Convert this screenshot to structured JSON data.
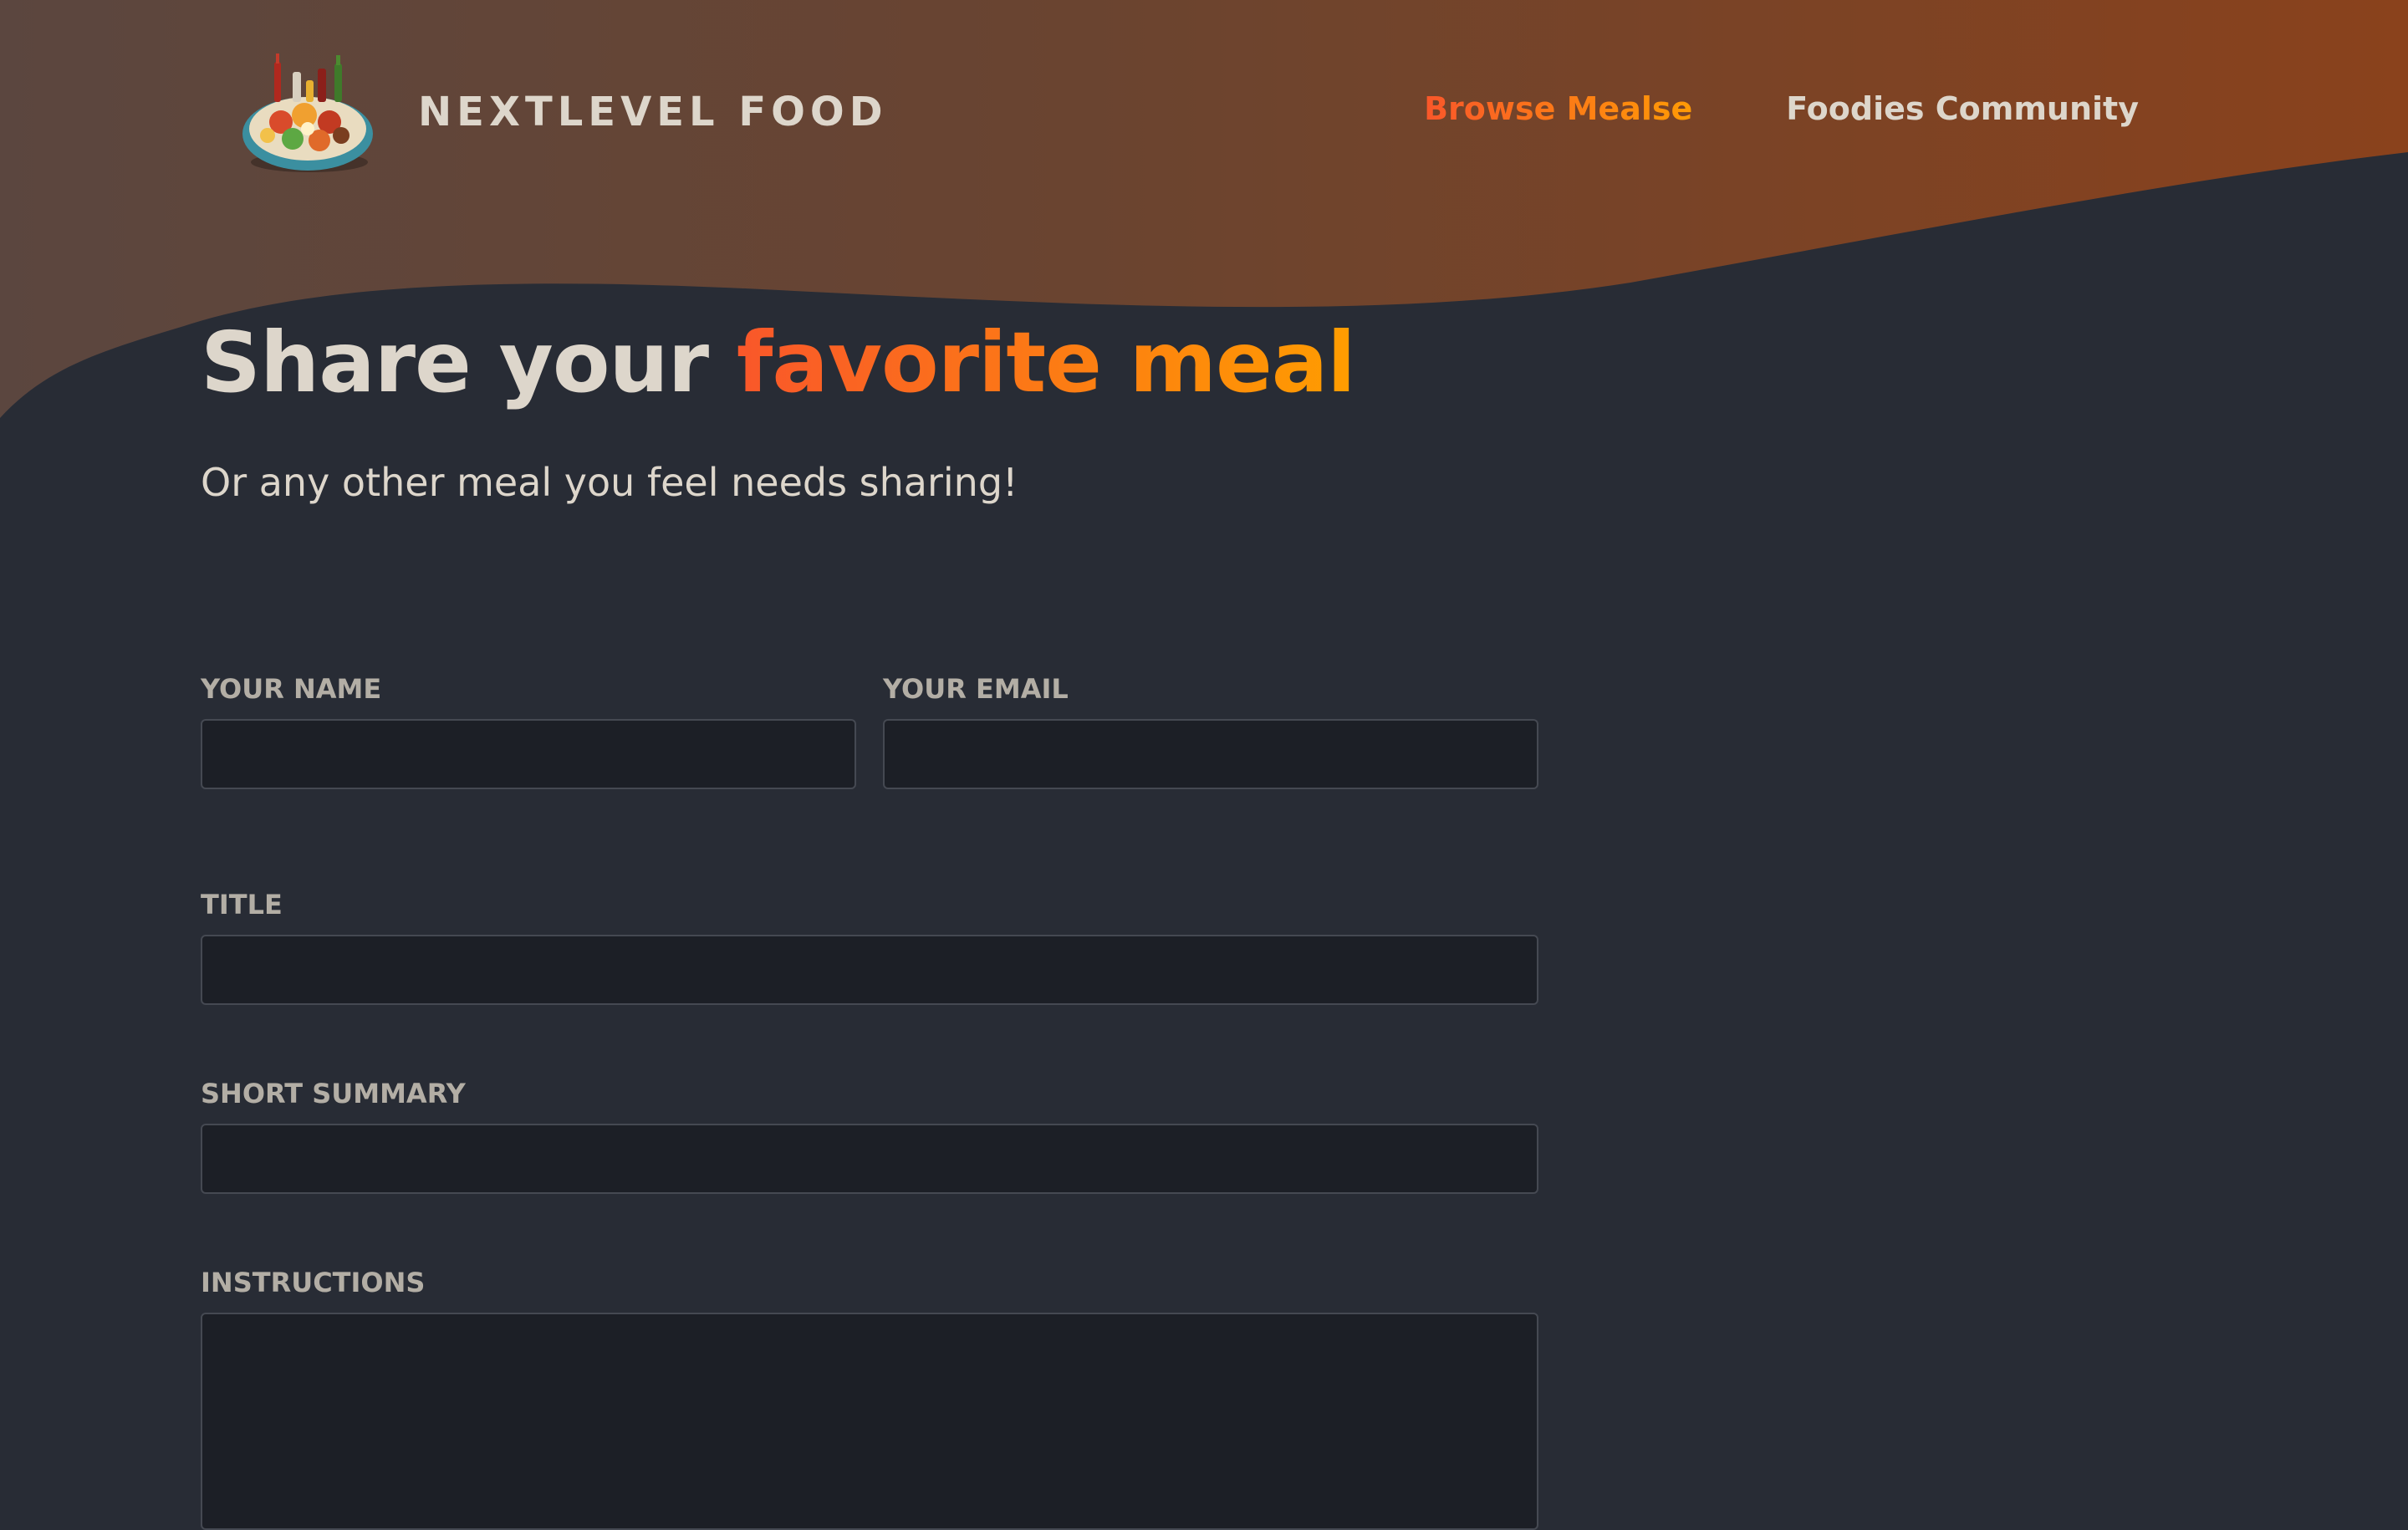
{
  "header": {
    "logo_alt": "A plate with food on it",
    "logo_text": "NextLevel Food",
    "nav": [
      {
        "label": "Browse Mealse",
        "active": true
      },
      {
        "label": "Foodies Community",
        "active": false
      }
    ]
  },
  "intro": {
    "title_plain": "Share your ",
    "title_highlight": "favorite meal",
    "subtitle": "Or any other meal you feel needs sharing!"
  },
  "form": {
    "name_label": "Your name",
    "name_value": "",
    "email_label": "Your email",
    "email_value": "",
    "title_label": "Title",
    "title_value": "",
    "summary_label": "Short Summary",
    "summary_value": "",
    "instructions_label": "Instructions",
    "instructions_value": ""
  },
  "colors": {
    "background": "#282c35",
    "text": "#ddd6cb",
    "label": "#b3aea5",
    "accent_start": "#f9572a",
    "accent_end": "#ff9b05",
    "header_gradient_start": "#5a4540",
    "header_gradient_end": "#8a421c"
  }
}
